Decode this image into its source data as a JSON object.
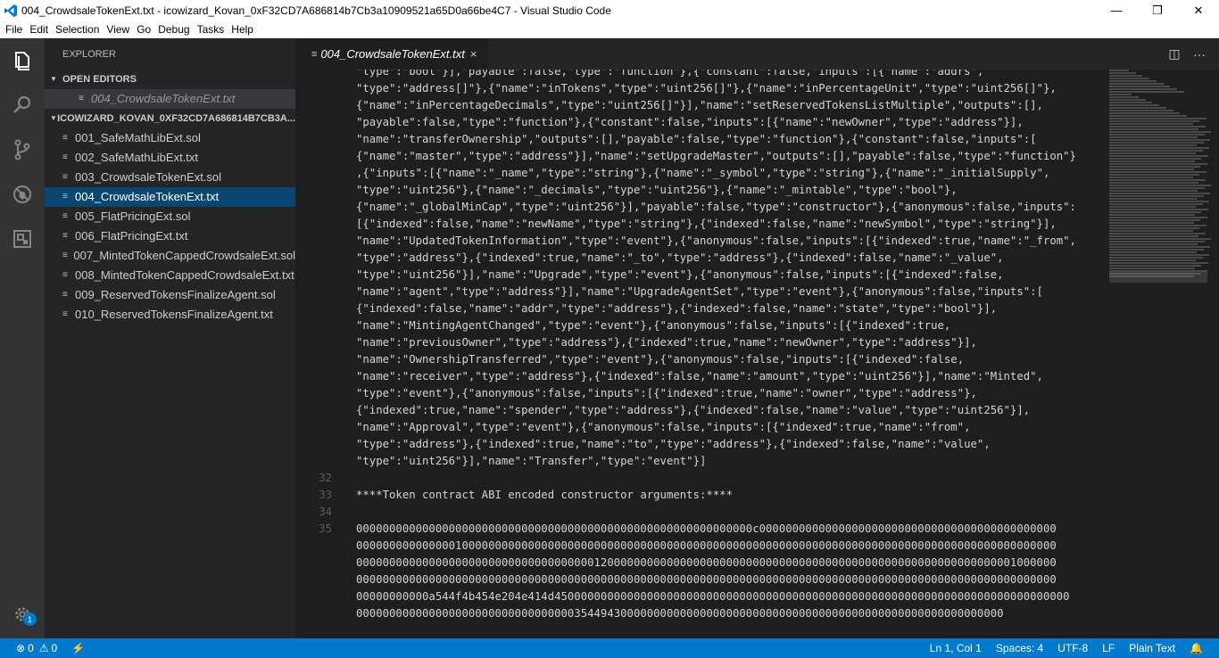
{
  "window": {
    "title": "004_CrowdsaleTokenExt.txt - icowizard_Kovan_0xF32CD7A686814b7Cb3a10909521a65D0a66be4C7 - Visual Studio Code",
    "minimize": "—",
    "maximize": "❐",
    "close": "✕"
  },
  "menu": [
    "File",
    "Edit",
    "Selection",
    "View",
    "Go",
    "Debug",
    "Tasks",
    "Help"
  ],
  "activity": {
    "icons": [
      "files-icon",
      "search-icon",
      "source-control-icon",
      "debug-icon",
      "extensions-icon"
    ],
    "manage_badge": "1"
  },
  "sidebar": {
    "title": "EXPLORER",
    "open_editors_header": "OPEN EDITORS",
    "open_editors": [
      {
        "label": "004_CrowdsaleTokenExt.txt"
      }
    ],
    "folder_header": "ICOWIZARD_KOVAN_0XF32CD7A686814B7CB3A...",
    "files": [
      {
        "label": "001_SafeMathLibExt.sol"
      },
      {
        "label": "002_SafeMathLibExt.txt"
      },
      {
        "label": "003_CrowdsaleTokenExt.sol"
      },
      {
        "label": "004_CrowdsaleTokenExt.txt"
      },
      {
        "label": "005_FlatPricingExt.sol"
      },
      {
        "label": "006_FlatPricingExt.txt"
      },
      {
        "label": "007_MintedTokenCappedCrowdsaleExt.sol"
      },
      {
        "label": "008_MintedTokenCappedCrowdsaleExt.txt"
      },
      {
        "label": "009_ReservedTokensFinalizeAgent.sol"
      },
      {
        "label": "010_ReservedTokensFinalizeAgent.txt"
      }
    ],
    "active_file_index": 3
  },
  "tab": {
    "label": "004_CrowdsaleTokenExt.txt",
    "close": "×"
  },
  "editor": {
    "lines": [
      {
        "num": "",
        "text": "\"type\":\"bool\"}],\"payable\":false,\"type\":\"function\"},{\"constant\":false,\"inputs\":[{\"name\":\"addrs\","
      },
      {
        "num": "",
        "text": "\"type\":\"address[]\"},{\"name\":\"inTokens\",\"type\":\"uint256[]\"},{\"name\":\"inPercentageUnit\",\"type\":\"uint256[]\"},"
      },
      {
        "num": "",
        "text": "{\"name\":\"inPercentageDecimals\",\"type\":\"uint256[]\"}],\"name\":\"setReservedTokensListMultiple\",\"outputs\":[],"
      },
      {
        "num": "",
        "text": "\"payable\":false,\"type\":\"function\"},{\"constant\":false,\"inputs\":[{\"name\":\"newOwner\",\"type\":\"address\"}],"
      },
      {
        "num": "",
        "text": "\"name\":\"transferOwnership\",\"outputs\":[],\"payable\":false,\"type\":\"function\"},{\"constant\":false,\"inputs\":["
      },
      {
        "num": "",
        "text": "{\"name\":\"master\",\"type\":\"address\"}],\"name\":\"setUpgradeMaster\",\"outputs\":[],\"payable\":false,\"type\":\"function\"}"
      },
      {
        "num": "",
        "text": ",{\"inputs\":[{\"name\":\"_name\",\"type\":\"string\"},{\"name\":\"_symbol\",\"type\":\"string\"},{\"name\":\"_initialSupply\","
      },
      {
        "num": "",
        "text": "\"type\":\"uint256\"},{\"name\":\"_decimals\",\"type\":\"uint256\"},{\"name\":\"_mintable\",\"type\":\"bool\"},"
      },
      {
        "num": "",
        "text": "{\"name\":\"_globalMinCap\",\"type\":\"uint256\"}],\"payable\":false,\"type\":\"constructor\"},{\"anonymous\":false,\"inputs\":"
      },
      {
        "num": "",
        "text": "[{\"indexed\":false,\"name\":\"newName\",\"type\":\"string\"},{\"indexed\":false,\"name\":\"newSymbol\",\"type\":\"string\"}],"
      },
      {
        "num": "",
        "text": "\"name\":\"UpdatedTokenInformation\",\"type\":\"event\"},{\"anonymous\":false,\"inputs\":[{\"indexed\":true,\"name\":\"_from\","
      },
      {
        "num": "",
        "text": "\"type\":\"address\"},{\"indexed\":true,\"name\":\"_to\",\"type\":\"address\"},{\"indexed\":false,\"name\":\"_value\","
      },
      {
        "num": "",
        "text": "\"type\":\"uint256\"}],\"name\":\"Upgrade\",\"type\":\"event\"},{\"anonymous\":false,\"inputs\":[{\"indexed\":false,"
      },
      {
        "num": "",
        "text": "\"name\":\"agent\",\"type\":\"address\"}],\"name\":\"UpgradeAgentSet\",\"type\":\"event\"},{\"anonymous\":false,\"inputs\":["
      },
      {
        "num": "",
        "text": "{\"indexed\":false,\"name\":\"addr\",\"type\":\"address\"},{\"indexed\":false,\"name\":\"state\",\"type\":\"bool\"}],"
      },
      {
        "num": "",
        "text": "\"name\":\"MintingAgentChanged\",\"type\":\"event\"},{\"anonymous\":false,\"inputs\":[{\"indexed\":true,"
      },
      {
        "num": "",
        "text": "\"name\":\"previousOwner\",\"type\":\"address\"},{\"indexed\":true,\"name\":\"newOwner\",\"type\":\"address\"}],"
      },
      {
        "num": "",
        "text": "\"name\":\"OwnershipTransferred\",\"type\":\"event\"},{\"anonymous\":false,\"inputs\":[{\"indexed\":false,"
      },
      {
        "num": "",
        "text": "\"name\":\"receiver\",\"type\":\"address\"},{\"indexed\":false,\"name\":\"amount\",\"type\":\"uint256\"}],\"name\":\"Minted\","
      },
      {
        "num": "",
        "text": "\"type\":\"event\"},{\"anonymous\":false,\"inputs\":[{\"indexed\":true,\"name\":\"owner\",\"type\":\"address\"},"
      },
      {
        "num": "",
        "text": "{\"indexed\":true,\"name\":\"spender\",\"type\":\"address\"},{\"indexed\":false,\"name\":\"value\",\"type\":\"uint256\"}],"
      },
      {
        "num": "",
        "text": "\"name\":\"Approval\",\"type\":\"event\"},{\"anonymous\":false,\"inputs\":[{\"indexed\":true,\"name\":\"from\","
      },
      {
        "num": "",
        "text": "\"type\":\"address\"},{\"indexed\":true,\"name\":\"to\",\"type\":\"address\"},{\"indexed\":false,\"name\":\"value\","
      },
      {
        "num": "",
        "text": "\"type\":\"uint256\"}],\"name\":\"Transfer\",\"type\":\"event\"}]"
      },
      {
        "num": "32",
        "text": ""
      },
      {
        "num": "33",
        "text": "****Token contract ABI encoded constructor arguments:****"
      },
      {
        "num": "34",
        "text": ""
      },
      {
        "num": "35",
        "text": "000000000000000000000000000000000000000000000000000000000000c000000000000000000000000000000000000000000000"
      },
      {
        "num": "",
        "text": "0000000000000001000000000000000000000000000000000000000000000000000000000000000000000000000000000000000000"
      },
      {
        "num": "",
        "text": "0000000000000000000000000000000000001200000000000000000000000000000000000000000000000000000000000001000000"
      },
      {
        "num": "",
        "text": "0000000000000000000000000000000000000000000000000000000000000000000000000000000000000000000000000000000000"
      },
      {
        "num": "",
        "text": "00000000000a544f4b454e204e414d450000000000000000000000000000000000000000000000000000000000000000000000000000"
      },
      {
        "num": "",
        "text": "00000000000000000000000000000000035449430000000000000000000000000000000000000000000000000000000000"
      }
    ]
  },
  "status": {
    "errors": "0",
    "warnings": "0",
    "position": "Ln 1, Col 1",
    "spaces": "Spaces: 4",
    "encoding": "UTF-8",
    "eol": "LF",
    "language": "Plain Text",
    "bell": "🔔"
  }
}
